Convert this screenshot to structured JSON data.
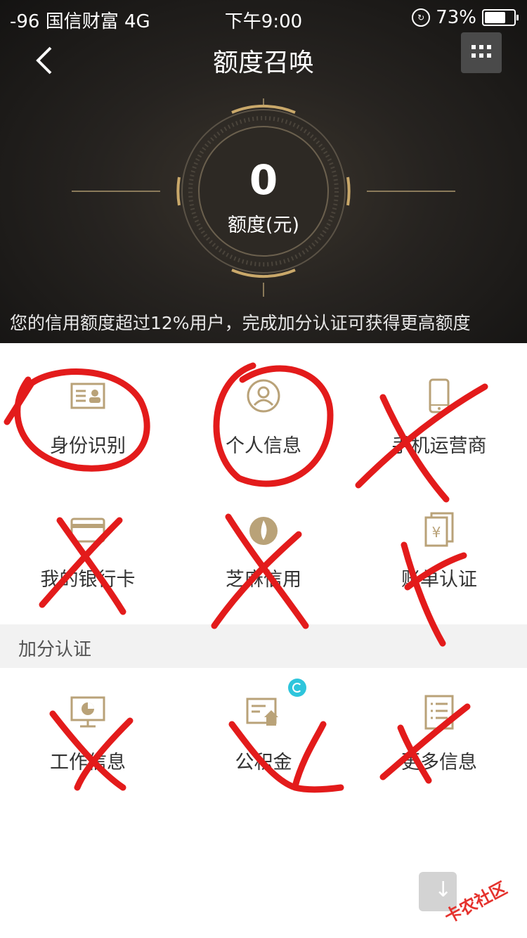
{
  "status_bar": {
    "signal": "-96",
    "carrier": "国信财富",
    "network": "4G",
    "time": "下午9:00",
    "battery": "73%",
    "battery_level": 0.73
  },
  "nav": {
    "title": "额度召唤",
    "back_icon": "chevron-left-icon",
    "menu_icon": "grid-dots-icon"
  },
  "hero": {
    "amount": "0",
    "amount_label": "额度(元)",
    "tip": "您的信用额度超过12%用户，完成加分认证可获得更高额度"
  },
  "basic_auth": [
    {
      "label": "身份识别",
      "icon": "id-card-icon"
    },
    {
      "label": "个人信息",
      "icon": "user-circle-icon"
    },
    {
      "label": "手机运营商",
      "icon": "phone-icon"
    },
    {
      "label": "我的银行卡",
      "icon": "bank-card-icon"
    },
    {
      "label": "芝麻信用",
      "icon": "sesame-icon"
    },
    {
      "label": "账单认证",
      "icon": "bill-icon"
    }
  ],
  "bonus_section": {
    "title": "加分认证"
  },
  "bonus_auth": [
    {
      "label": "工作信息",
      "icon": "work-monitor-icon"
    },
    {
      "label": "公积金",
      "icon": "fund-icon"
    },
    {
      "label": "更多信息",
      "icon": "document-list-icon"
    }
  ],
  "watermark": {
    "text": "卡农社区"
  },
  "colors": {
    "accent_gold": "#c9a86a",
    "icon_gold": "#b9a278",
    "annotation_red": "#e31b1b",
    "hero_bg": "#1f1d1b"
  }
}
